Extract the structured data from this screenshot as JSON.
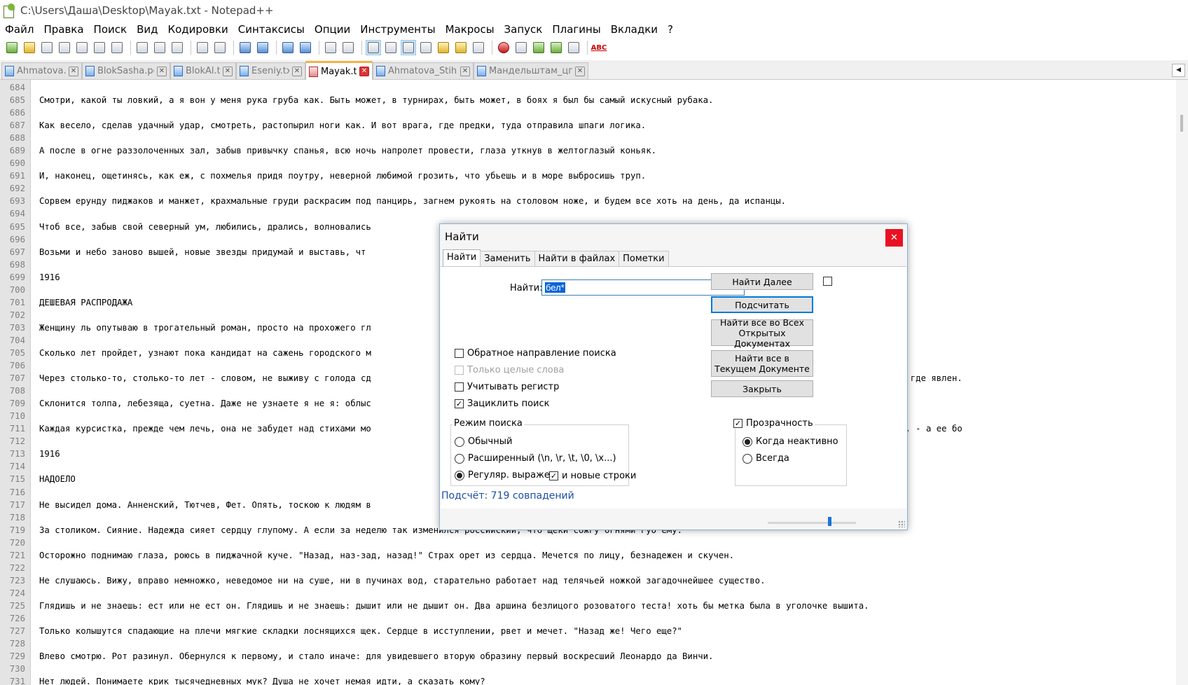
{
  "window": {
    "title": "C:\\Users\\Даша\\Desktop\\Mayak.txt - Notepad++"
  },
  "menu": [
    "Файл",
    "Правка",
    "Поиск",
    "Вид",
    "Кодировки",
    "Синтаксисы",
    "Опции",
    "Инструменты",
    "Макросы",
    "Запуск",
    "Плагины",
    "Вкладки",
    "?"
  ],
  "toolbar": {
    "icons": [
      "new-file-icon",
      "open-file-icon",
      "save-icon",
      "save-all-icon",
      "close-icon",
      "close-all-icon",
      "print-icon",
      "cut-icon",
      "copy-icon",
      "paste-icon",
      "undo-icon",
      "redo-icon",
      "find-icon",
      "replace-icon",
      "zoom-in-icon",
      "zoom-out-icon",
      "sync-vertical-icon",
      "sync-horizontal-icon",
      "word-wrap-icon",
      "show-all-chars-icon",
      "indent-guide-icon",
      "user-language-icon",
      "function-list-icon",
      "folder-as-workspace-icon",
      "monitoring-icon",
      "record-macro-icon",
      "stop-macro-icon",
      "play-macro-icon",
      "run-macro-multiple-icon",
      "save-macro-icon",
      "spellcheck-icon"
    ],
    "spellcheck_label": "ABC"
  },
  "tabs": [
    {
      "label": "Ahmatova.txt",
      "active": false
    },
    {
      "label": "BlokSasha.pdf",
      "active": false
    },
    {
      "label": "BlokAl.txt",
      "active": false
    },
    {
      "label": "Eseniy.txt",
      "active": false
    },
    {
      "label": "Mayak.txt",
      "active": true
    },
    {
      "label": "Ahmatova_Stih.txt",
      "active": false
    },
    {
      "label": "Мандельштам_цг.txt",
      "active": false
    }
  ],
  "editor": {
    "lines": [
      {
        "n": "684",
        "t": ""
      },
      {
        "n": "685",
        "t": "Смотри, какой ты ловкий, а я вон у меня рука груба как. Быть может, в турнирах, быть может, в боях я был бы самый искусный рубака."
      },
      {
        "n": "686",
        "t": ""
      },
      {
        "n": "687",
        "t": "Как весело, сделав удачный удар, смотреть, растопырил ноги как. И вот врага, где предки, туда отправила шпаги логика."
      },
      {
        "n": "688",
        "t": ""
      },
      {
        "n": "689",
        "t": "А после в огне раззолоченных зал, забыв привычку спанья, всю ночь напролет провести, глаза уткнув в желтоглазый коньяк."
      },
      {
        "n": "690",
        "t": ""
      },
      {
        "n": "691",
        "t": "И, наконец, ощетинясь, как еж, с похмелья придя поутру, неверной любимой грозить, что убьешь и в море выбросишь труп."
      },
      {
        "n": "692",
        "t": ""
      },
      {
        "n": "693",
        "t": "Сорвем ерунду пиджаков и манжет, крахмальные груди раскрасим под панцирь, загнем рукоять на столовом ноже, и будем все хоть на день, да испанцы."
      },
      {
        "n": "694",
        "t": ""
      },
      {
        "n": "695",
        "t": "Чтоб все, забыв свой северный ум, любились, дрались, волновались"
      },
      {
        "n": "696",
        "t": ""
      },
      {
        "n": "697",
        "t": "Возьми и небо заново вышей, новые звезды придумай и выставь, чт"
      },
      {
        "n": "698",
        "t": ""
      },
      {
        "n": "699",
        "t": "1916"
      },
      {
        "n": "700",
        "t": ""
      },
      {
        "n": "701",
        "t": "ДЕШЕВАЯ РАСПРОДАЖА"
      },
      {
        "n": "702",
        "t": ""
      },
      {
        "n": "703",
        "t": "Женщину ль опутываю в трогательный роман, просто на прохожего гл                                                                      тить?"
      },
      {
        "n": "704",
        "t": ""
      },
      {
        "n": "705",
        "t": "Сколько лет пройдет, узнают пока кандидат на сажень городского м"
      },
      {
        "n": "706",
        "t": ""
      },
      {
        "n": "707",
        "t": "Через столько-то, столько-то лет - словом, не выживу с голода сд                                                                      жат до последних йот, как, когда, где явлен."
      },
      {
        "n": "708",
        "t": ""
      },
      {
        "n": "709",
        "t": "Склонится толпа, лебезяща, суетна. Даже не узнаете я не я: облыс"
      },
      {
        "n": "710",
        "t": ""
      },
      {
        "n": "711",
        "t": "Каждая курсистка, прежде чем лечь, она не забудет над стихами мо                                                                      айте ж: все, чем владеет моя душа, - а ее бо"
      },
      {
        "n": "712",
        "t": ""
      },
      {
        "n": "713",
        "t": "1916"
      },
      {
        "n": "714",
        "t": ""
      },
      {
        "n": "715",
        "t": "НАДОЕЛО"
      },
      {
        "n": "716",
        "t": ""
      },
      {
        "n": "717",
        "t": "Не высидел дома. Анненский, Тютчев, Фет. Опять, тоскою к людям в"
      },
      {
        "n": "718",
        "t": ""
      },
      {
        "n": "719",
        "t": "За столиком. Сияние. Надежда сияет сердцу глупому. А если за неделю так изменился российский, что щеки сожгу огнями губ ему."
      },
      {
        "n": "720",
        "t": ""
      },
      {
        "n": "721",
        "t": "Осторожно поднимаю глаза, роюсь в пиджачной куче. \"Назад, наз-зад, назад!\" Страх орет из сердца. Мечется по лицу, безнадежен и скучен."
      },
      {
        "n": "722",
        "t": ""
      },
      {
        "n": "723",
        "t": "Не слушаюсь. Вижу, вправо немножко, неведомое ни на суше, ни в пучинах вод, старательно работает над телячьей ножкой загадочнейшее существо."
      },
      {
        "n": "724",
        "t": ""
      },
      {
        "n": "725",
        "t": "Глядишь и не знаешь: ест или не ест он. Глядишь и не знаешь: дышит или не дышит он. Два аршина безлицого розоватого теста! хоть бы метка была в уголочке вышита."
      },
      {
        "n": "726",
        "t": ""
      },
      {
        "n": "727",
        "t": "Только колышутся спадающие на плечи мягкие складки лоснящихся щек. Сердце в исступлении, рвет и мечет. \"Назад же! Чего еще?\""
      },
      {
        "n": "728",
        "t": ""
      },
      {
        "n": "729",
        "t": "Влево смотрю. Рот разинул. Обернулся к первому, и стало иначе: для увидевшего вторую образину первый воскресший Леонардо да Винчи."
      },
      {
        "n": "730",
        "t": ""
      },
      {
        "n": "731",
        "t": "Нет людей. Понимаете крик тысячедневных мук? Душа не хочет немая идти, а сказать кому?"
      }
    ]
  },
  "find_dialog": {
    "title": "Найти",
    "close_glyph": "✕",
    "tabs": [
      "Найти",
      "Заменить",
      "Найти в файлах",
      "Пометки"
    ],
    "find_label": "Найти:",
    "find_value": "бел*",
    "buttons": {
      "find_next": "Найти Далее",
      "count": "Подсчитать",
      "find_all_open_1": "Найти все во Всех",
      "find_all_open_2": "Открытых Документах",
      "find_all_current_1": "Найти все в",
      "find_all_current_2": "Текущем Документе",
      "close": "Закрыть"
    },
    "options": {
      "backward": {
        "label": "Обратное направление поиска",
        "checked": false
      },
      "whole_word": {
        "label": "Только целые слова",
        "checked": false,
        "disabled": true
      },
      "match_case": {
        "label": "Учитывать регистр",
        "checked": false
      },
      "wrap": {
        "label": "Зациклить поиск",
        "checked": true
      }
    },
    "search_mode": {
      "title": "Режим поиска",
      "normal": "Обычный",
      "extended": "Расширенный (\\n, \\r, \\t, \\0, \\x...)",
      "regex": "Регуляр. выражен.",
      "dot_newline": "и новые строки",
      "selected": "regex"
    },
    "transparency": {
      "title": "Прозрачность",
      "checked": true,
      "on_lose_focus": "Когда неактивно",
      "always": "Всегда",
      "selected": "on_lose_focus",
      "level": 0.7
    },
    "status": "Подсчёт: 719 совпадений"
  }
}
